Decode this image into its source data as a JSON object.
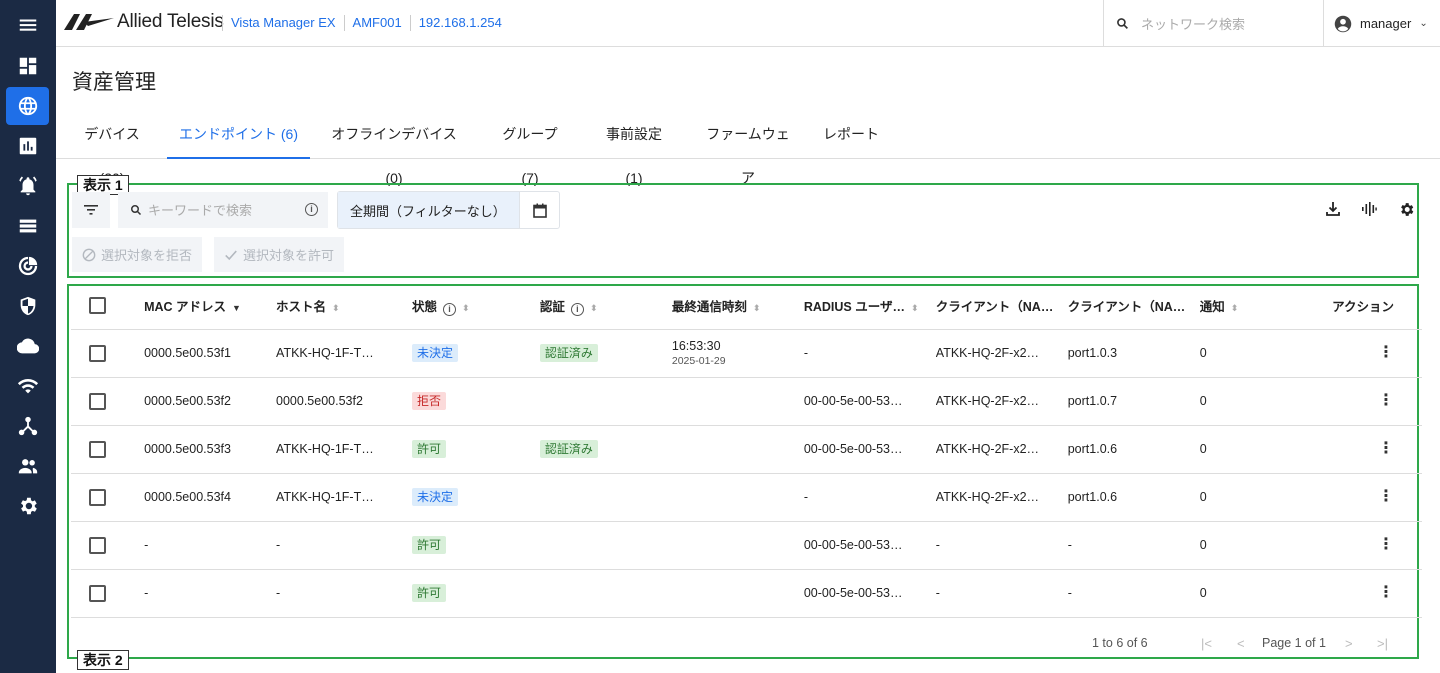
{
  "header": {
    "brand": "Allied Telesis",
    "breadcrumbs": [
      "Vista Manager EX",
      "AMF001",
      "192.168.1.254"
    ],
    "search_placeholder": "ネットワーク検索",
    "user": "manager"
  },
  "sidebar": {
    "items": [
      "menu-icon",
      "dashboard-icon",
      "globe-icon",
      "chart-icon",
      "alarm-icon",
      "list-icon",
      "target-icon",
      "shield-icon",
      "cloud-icon",
      "wifi-icon",
      "topology-icon",
      "people-icon",
      "gear-icon"
    ],
    "active_index": 2
  },
  "page": {
    "title": "資産管理"
  },
  "tabs": [
    {
      "label": "デバイス (20)"
    },
    {
      "label": "エンドポイント (6)"
    },
    {
      "label": "オフラインデバイス (0)"
    },
    {
      "label": "グループ (7)"
    },
    {
      "label": "事前設定 (1)"
    },
    {
      "label": "ファームウェア"
    },
    {
      "label": "レポート"
    }
  ],
  "annotations": {
    "box1": "表示 1",
    "box2": "表示 2"
  },
  "toolbar": {
    "keyword_placeholder": "キーワードで検索",
    "period": "全期間（フィルターなし）",
    "reject_label": "選択対象を拒否",
    "allow_label": "選択対象を許可"
  },
  "table": {
    "columns": [
      "MAC アドレス",
      "ホスト名",
      "状態",
      "認証",
      "最終通信時刻",
      "RADIUS ユーザ…",
      "クライアント（NA…",
      "クライアント（NA…",
      "通知",
      "アクション"
    ],
    "rows": [
      {
        "mac": "0000.5e00.53f1",
        "host": "ATKK-HQ-1F-T…",
        "state": "未決定",
        "auth": "認証済み",
        "time": "16:53:30",
        "date": "2025-01-29",
        "radius": "-",
        "client1": "ATKK-HQ-2F-x2…",
        "client2": "port1.0.3",
        "notify": "0"
      },
      {
        "mac": "0000.5e00.53f2",
        "host": "0000.5e00.53f2",
        "state": "拒否",
        "auth": "",
        "time": "",
        "date": "",
        "radius": "00-00-5e-00-53…",
        "client1": "ATKK-HQ-2F-x2…",
        "client2": "port1.0.7",
        "notify": "0"
      },
      {
        "mac": "0000.5e00.53f3",
        "host": "ATKK-HQ-1F-T…",
        "state": "許可",
        "auth": "認証済み",
        "time": "",
        "date": "",
        "radius": "00-00-5e-00-53…",
        "client1": "ATKK-HQ-2F-x2…",
        "client2": "port1.0.6",
        "notify": "0"
      },
      {
        "mac": "0000.5e00.53f4",
        "host": "ATKK-HQ-1F-T…",
        "state": "未決定",
        "auth": "",
        "time": "",
        "date": "",
        "radius": "-",
        "client1": "ATKK-HQ-2F-x2…",
        "client2": "port1.0.6",
        "notify": "0"
      },
      {
        "mac": "-",
        "host": "-",
        "state": "許可",
        "auth": "",
        "time": "",
        "date": "",
        "radius": "00-00-5e-00-53…",
        "client1": "-",
        "client2": "-",
        "notify": "0"
      },
      {
        "mac": "-",
        "host": "-",
        "state": "許可",
        "auth": "",
        "time": "",
        "date": "",
        "radius": "00-00-5e-00-53…",
        "client1": "-",
        "client2": "-",
        "notify": "0"
      }
    ]
  },
  "pagination": {
    "range": "1 to 6 of 6",
    "page": "Page 1 of 1"
  },
  "colors": {
    "accent": "#1f6fe8",
    "sidebar": "#1b2a44",
    "annotation": "#2ea84a"
  }
}
